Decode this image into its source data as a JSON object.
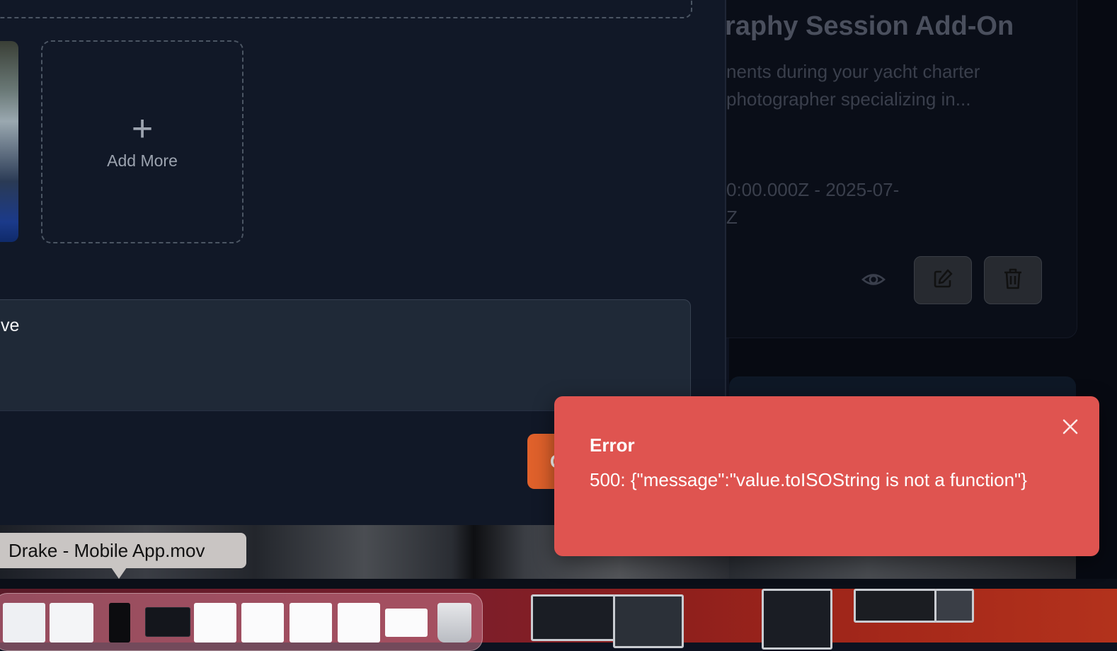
{
  "background_page": {
    "title": "raphy Session Add-On",
    "description_line1": "nents during your yacht charter",
    "description_line2": "photographer specializing in...",
    "dates_line1": "0:00.000Z - 2025-07-",
    "dates_line2": "Z"
  },
  "modal": {
    "add_more_icon": "+",
    "add_more_label": "Add More",
    "textarea_value": "ve",
    "primary_button_label": "C"
  },
  "dock": {
    "tooltip": "Drake - Mobile App.mov"
  },
  "toast": {
    "title": "Error",
    "message": "500: {\"message\":\"value.toISOString is not a function\"}",
    "close_icon": "close-icon"
  },
  "colors": {
    "toast_bg": "#df5450",
    "modal_bg": "#111827",
    "primary_button": "#e0612b"
  }
}
